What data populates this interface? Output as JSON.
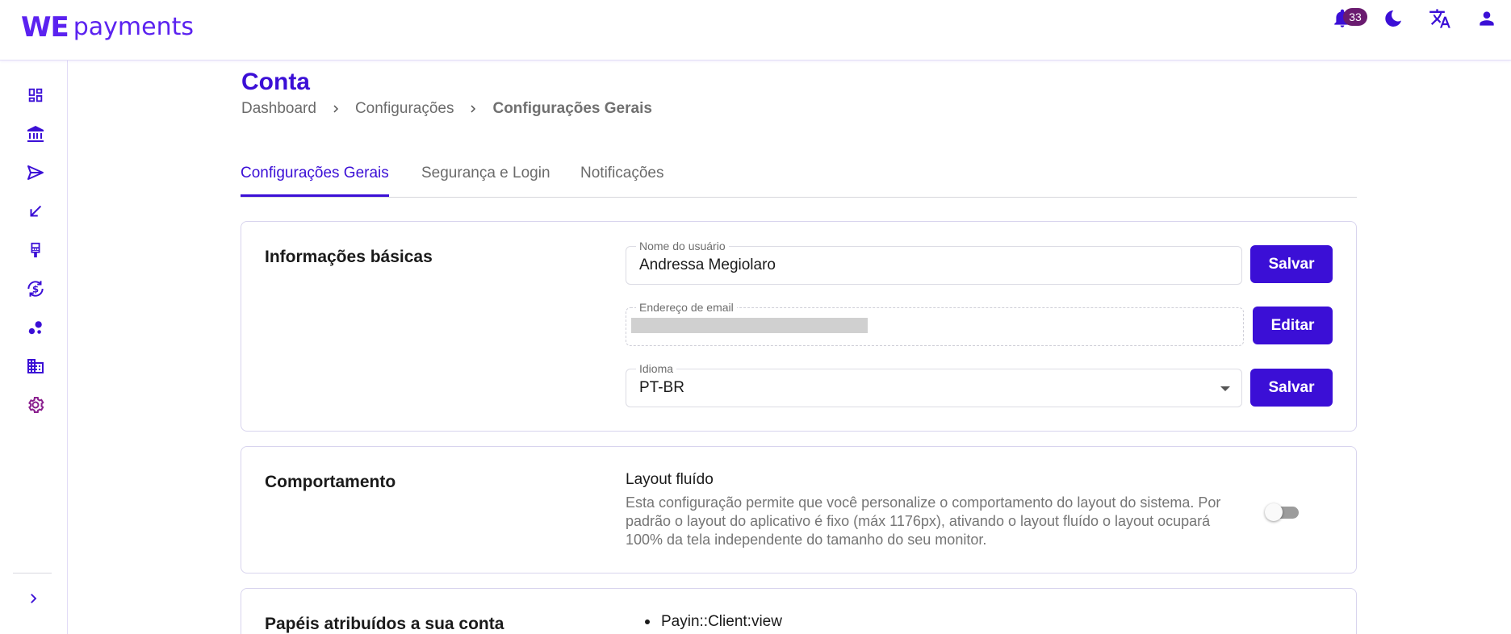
{
  "app": {
    "logo_we": "WE",
    "logo_text": "payments",
    "brand_color": "#3b0fd6"
  },
  "header": {
    "notifications_count": "33",
    "icons": [
      "bell-icon",
      "moon-icon",
      "translate-icon",
      "user-icon"
    ]
  },
  "sidebar": {
    "items": [
      {
        "icon": "dashboard-icon"
      },
      {
        "icon": "bank-icon"
      },
      {
        "icon": "send-icon"
      },
      {
        "icon": "receive-arrow-icon"
      },
      {
        "icon": "pos-terminal-icon"
      },
      {
        "icon": "currency-exchange-icon"
      },
      {
        "icon": "bubbles-icon"
      },
      {
        "icon": "building-icon"
      },
      {
        "icon": "settings-gear-icon"
      }
    ],
    "expand_icon": "chevron-right-icon"
  },
  "page": {
    "title": "Conta",
    "breadcrumb": [
      "Dashboard",
      "Configurações",
      "Configurações Gerais"
    ]
  },
  "tabs": [
    {
      "label": "Configurações Gerais",
      "active": true
    },
    {
      "label": "Segurança e Login",
      "active": false
    },
    {
      "label": "Notificações",
      "active": false
    }
  ],
  "basic_info": {
    "title": "Informações básicas",
    "username_label": "Nome do usuário",
    "username_value": "Andressa Megiolaro",
    "email_label": "Endereço de email",
    "language_label": "Idioma",
    "language_value": "PT-BR",
    "save_label": "Salvar",
    "edit_label": "Editar"
  },
  "behavior": {
    "title": "Comportamento",
    "setting_title": "Layout fluído",
    "setting_desc": "Esta configuração permite que você personalize o comportamento do layout do sistema. Por padrão o layout do aplicativo é fixo (máx 1176px), ativando o layout fluído o layout ocupará 100% da tela independente do tamanho do seu monitor.",
    "fluid_layout_enabled": false
  },
  "roles": {
    "title": "Papéis atribuídos a sua conta",
    "items": [
      "Payin::Client:view"
    ]
  }
}
